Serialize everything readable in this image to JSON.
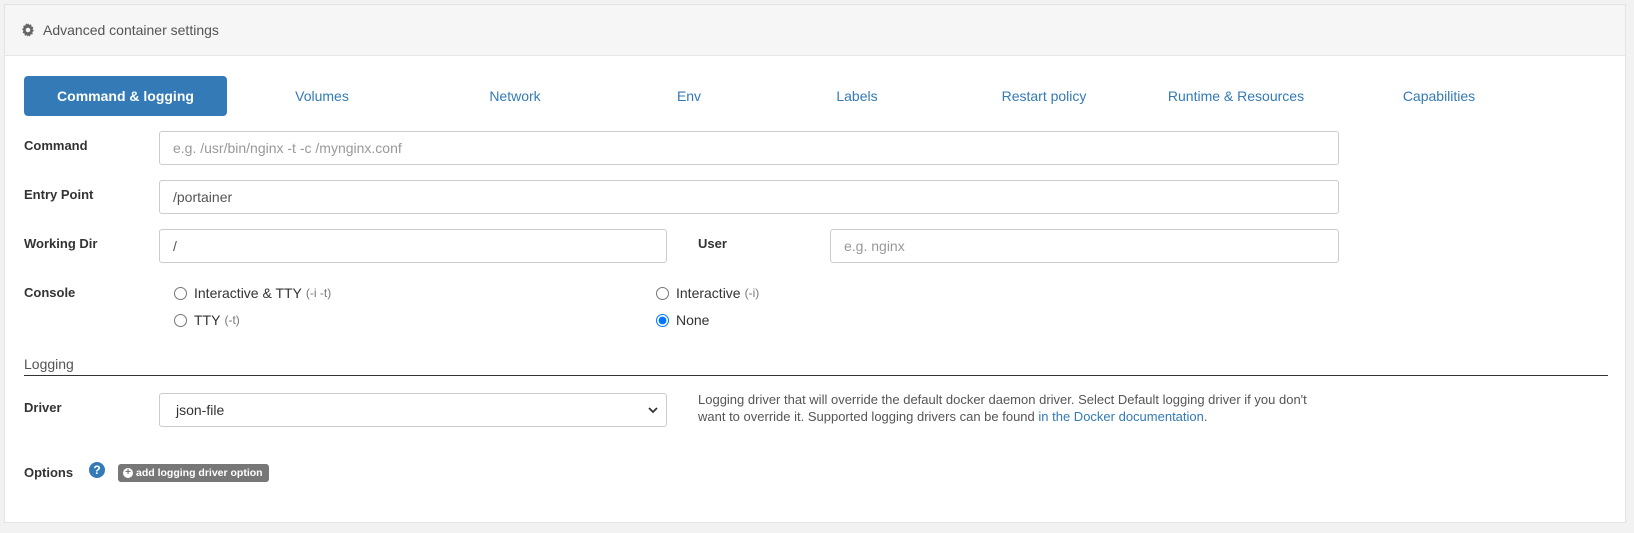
{
  "panel": {
    "title": "Advanced container settings",
    "icon": "gear-icon"
  },
  "tabs": [
    {
      "label": "Command & logging",
      "active": true
    },
    {
      "label": "Volumes"
    },
    {
      "label": "Network"
    },
    {
      "label": "Env"
    },
    {
      "label": "Labels"
    },
    {
      "label": "Restart policy"
    },
    {
      "label": "Runtime & Resources"
    },
    {
      "label": "Capabilities"
    }
  ],
  "form": {
    "command": {
      "label": "Command",
      "value": "",
      "placeholder": "e.g. /usr/bin/nginx -t -c /mynginx.conf"
    },
    "entrypoint": {
      "label": "Entry Point",
      "value": "/portainer",
      "placeholder": ""
    },
    "workingdir": {
      "label": "Working Dir",
      "value": "/",
      "placeholder": ""
    },
    "user": {
      "label": "User",
      "value": "",
      "placeholder": "e.g. nginx"
    },
    "console": {
      "label": "Console",
      "options": [
        {
          "label": "Interactive & TTY",
          "hint": "(-i -t)",
          "checked": false
        },
        {
          "label": "Interactive",
          "hint": "(-i)",
          "checked": false
        },
        {
          "label": "TTY",
          "hint": "(-t)",
          "checked": false
        },
        {
          "label": "None",
          "hint": "",
          "checked": true
        }
      ]
    }
  },
  "logging": {
    "section_title": "Logging",
    "driver_label": "Driver",
    "driver_value": "json-file",
    "help_text": "Logging driver that will override the default docker daemon driver. Select Default logging driver if you don't want to override it. Supported logging drivers can be found",
    "help_link": "in the Docker documentation",
    "help_end": ".",
    "options_label": "Options",
    "add_option_label": "add logging driver option"
  },
  "colors": {
    "accent": "#337ab7",
    "button_gray": "#777777"
  }
}
